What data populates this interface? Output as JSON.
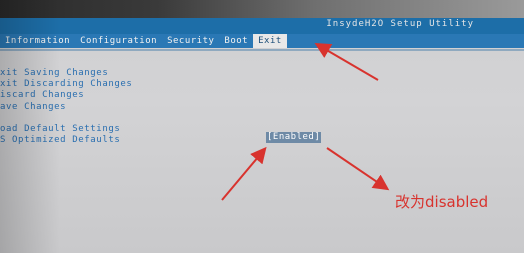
{
  "app_title": "InsydeH2O Setup Utility",
  "menu": [
    {
      "label": "Information",
      "active": false
    },
    {
      "label": "Configuration",
      "active": false
    },
    {
      "label": "Security",
      "active": false
    },
    {
      "label": "Boot",
      "active": false
    },
    {
      "label": "Exit",
      "active": true
    }
  ],
  "options": [
    {
      "label": "xit Saving Changes"
    },
    {
      "label": "xit Discarding Changes"
    },
    {
      "label": "iscard Changes"
    },
    {
      "label": "ave Changes"
    },
    {
      "label": "oad Default Settings"
    },
    {
      "label": "S Optimized Defaults",
      "value": "[Enabled]"
    }
  ],
  "annotation_text": "改为disabled",
  "colors": {
    "menu_bg": "#2a78b5",
    "option_text": "#2a6fb0",
    "annotation": "#d8332e"
  }
}
